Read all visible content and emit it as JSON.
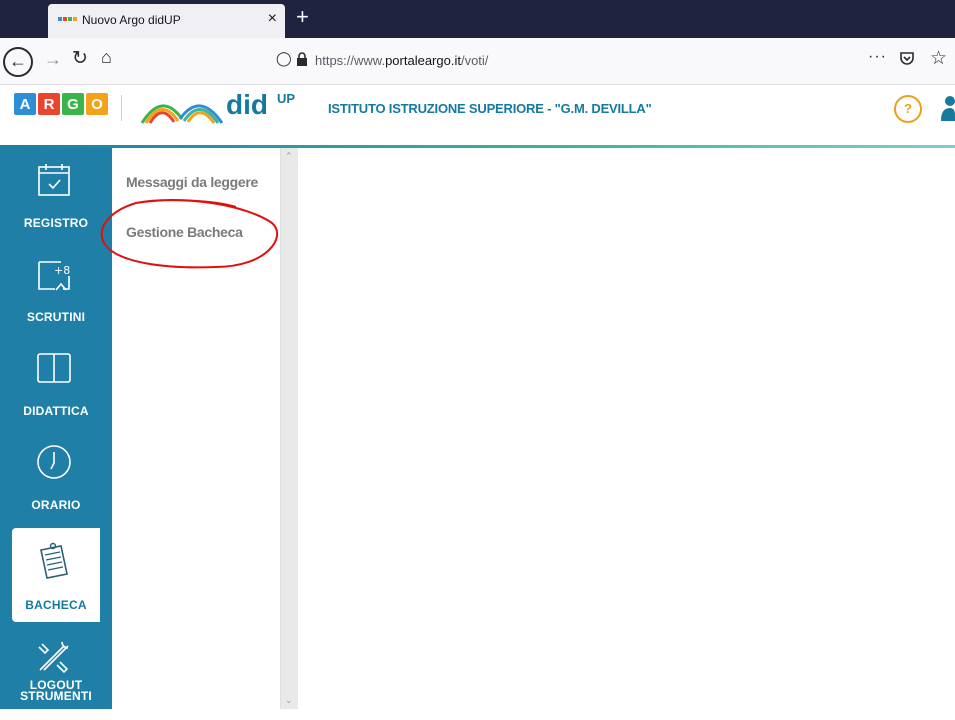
{
  "browser": {
    "tab_title": "Nuovo Argo didUP",
    "tab_close": "×",
    "new_tab": "+",
    "url_prefix": "https://www.",
    "url_domain": "portaleargo.it",
    "url_path": "/voti/",
    "more_label": "···"
  },
  "header": {
    "argo_letters": [
      "A",
      "R",
      "G",
      "O"
    ],
    "argo_colors": [
      "#2f8fd6",
      "#e8452c",
      "#3bb54a",
      "#f4a21c"
    ],
    "app_word": "did",
    "app_suffix": "UP",
    "school_name": "ISTITUTO ISTRUZIONE SUPERIORE - \"G.M. DEVILLA\"",
    "help_label": "?"
  },
  "sidebar": {
    "items": [
      {
        "label": "REGISTRO",
        "icon": "calendar-check-icon"
      },
      {
        "label": "SCRUTINI",
        "icon": "grade-plus-icon"
      },
      {
        "label": "DIDATTICA",
        "icon": "book-icon"
      },
      {
        "label": "ORARIO",
        "icon": "clock-icon"
      },
      {
        "label": "BACHECA",
        "icon": "bulletin-board-icon",
        "active": true
      },
      {
        "label_line1": "LOGOUT",
        "label_line2": "STRUMENTI",
        "icon": "tools-icon"
      }
    ]
  },
  "submenu": {
    "items": [
      {
        "label": "Messaggi da leggere"
      },
      {
        "label": "Gestione Bacheca",
        "annotated": true
      }
    ]
  },
  "colors": {
    "accent": "#1f7fa6",
    "annotation": "#e01010",
    "help": "#e9a11b"
  }
}
